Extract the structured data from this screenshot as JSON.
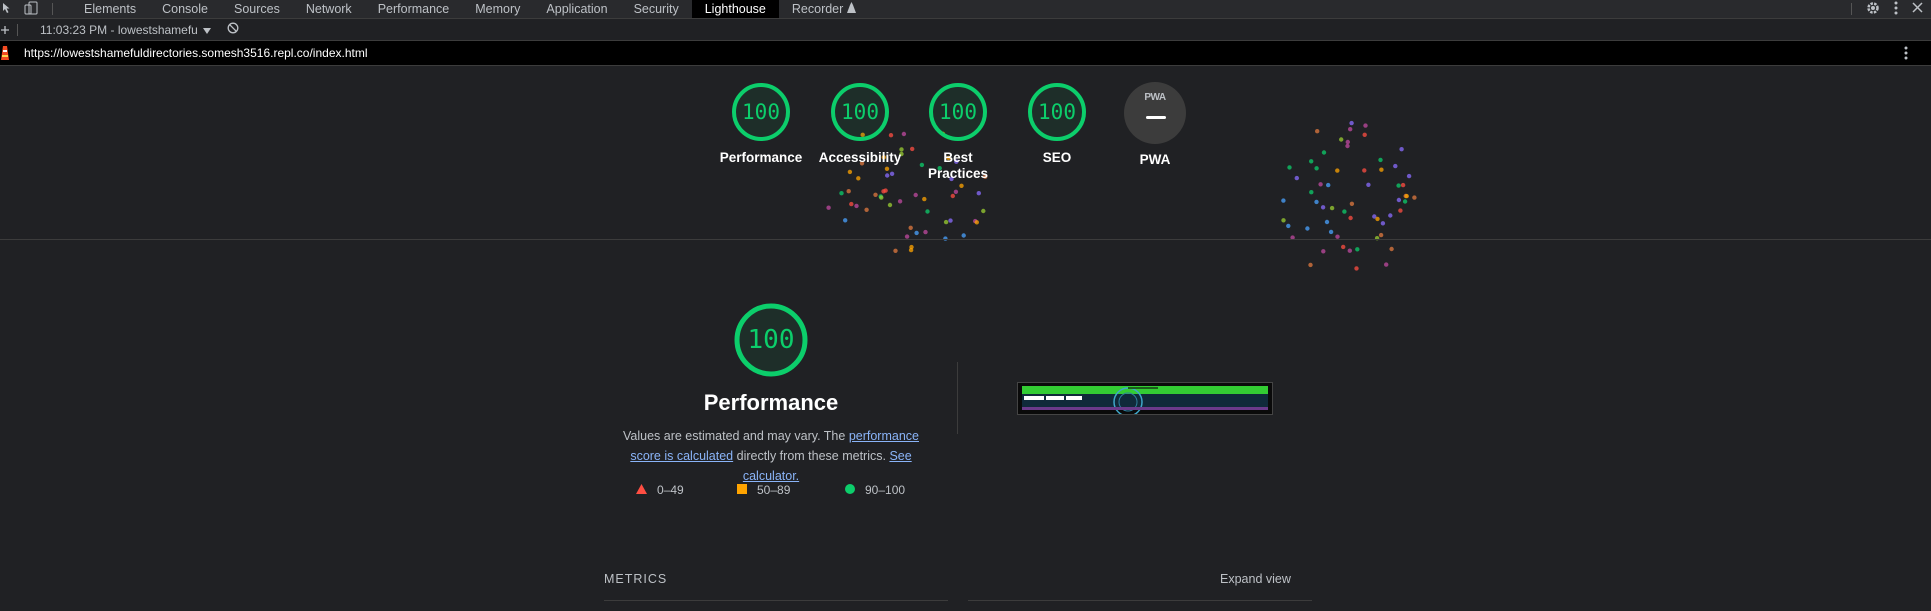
{
  "devtools": {
    "tabs": [
      "Elements",
      "Console",
      "Sources",
      "Network",
      "Performance",
      "Memory",
      "Application",
      "Security",
      "Lighthouse",
      "Recorder"
    ],
    "active_tab": "Lighthouse",
    "icons": [
      "inspect-icon",
      "device-toggle-icon",
      "recorder-icon",
      "settings-gear-icon",
      "kebab-menu-icon",
      "close-icon"
    ]
  },
  "toolbar": {
    "report_label": "11:03:23 PM - lowestshamefu",
    "icons": [
      "plus-icon",
      "dropdown-arrow-icon",
      "clear-block-icon"
    ]
  },
  "urlbar": {
    "url": "https://lowestshamefuldirectories.somesh3516.repl.co/index.html"
  },
  "gauges": [
    {
      "label": "Performance",
      "score": "100"
    },
    {
      "label": "Accessibility",
      "score": "100"
    },
    {
      "label": "Best Practices",
      "score": "100"
    },
    {
      "label": "SEO",
      "score": "100"
    },
    {
      "label": "PWA",
      "badge": "PWA",
      "score": "—"
    }
  ],
  "performance": {
    "score": "100",
    "title": "Performance",
    "desc_prefix": "Values are estimated and may vary. The ",
    "link_score": "performance score is calculated",
    "desc_mid": " directly from these metrics. ",
    "link_calc": "See calculator.",
    "legend": [
      {
        "range": "0–49",
        "color": "#ff4e42",
        "shape": "triangle"
      },
      {
        "range": "50–89",
        "color": "#ffa400",
        "shape": "square"
      },
      {
        "range": "90–100",
        "color": "#0cce6b",
        "shape": "circle"
      }
    ]
  },
  "metrics": {
    "header": "METRICS",
    "expand_label": "Expand view"
  },
  "colors": {
    "pass": "#0cce6b",
    "background": "#202124",
    "link": "#8ab4f8"
  }
}
